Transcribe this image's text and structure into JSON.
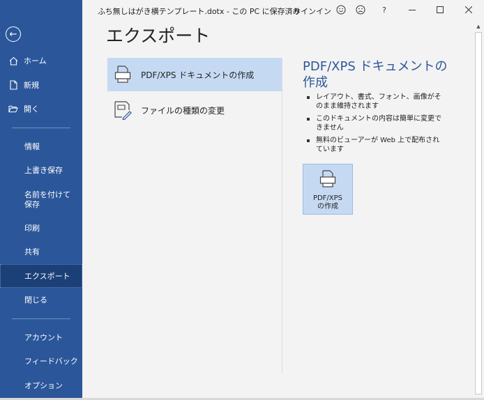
{
  "window": {
    "title": "ふち無しはがき横テンプレート.dotx - この PC に保存済み",
    "signin": "サインイン"
  },
  "sidebar": {
    "top_items": [
      {
        "label": "ホーム",
        "icon": "home-icon"
      },
      {
        "label": "新規",
        "icon": "new-document-icon"
      },
      {
        "label": "開く",
        "icon": "open-folder-icon"
      }
    ],
    "middle_items": [
      {
        "label": "情報"
      },
      {
        "label": "上書き保存"
      },
      {
        "label": "名前を付けて保存"
      },
      {
        "label": "印刷"
      },
      {
        "label": "共有"
      },
      {
        "label": "エクスポート",
        "active": true
      },
      {
        "label": "閉じる"
      }
    ],
    "bottom_items": [
      {
        "label": "アカウント"
      },
      {
        "label": "フィードバック"
      },
      {
        "label": "オプション"
      }
    ]
  },
  "main": {
    "heading": "エクスポート",
    "options": [
      {
        "label": "PDF/XPS ドキュメントの作成",
        "icon": "pdf-document-icon",
        "selected": true
      },
      {
        "label": "ファイルの種類の変更",
        "icon": "change-file-type-icon"
      }
    ],
    "detail": {
      "title": "PDF/XPS ドキュメントの作成",
      "bullets": [
        "レイアウト、書式、フォント、画像がそのまま維持されます",
        "このドキュメントの内容は簡単に変更できません",
        "無料のビューアーが Web 上で配布されています"
      ],
      "button_label": "PDF/XPS の作成"
    }
  },
  "colors": {
    "sidebar": "#2b579a",
    "sidebar_active": "#1b3f77",
    "selected_option": "#c5daf2",
    "accent_text": "#2b579a"
  }
}
